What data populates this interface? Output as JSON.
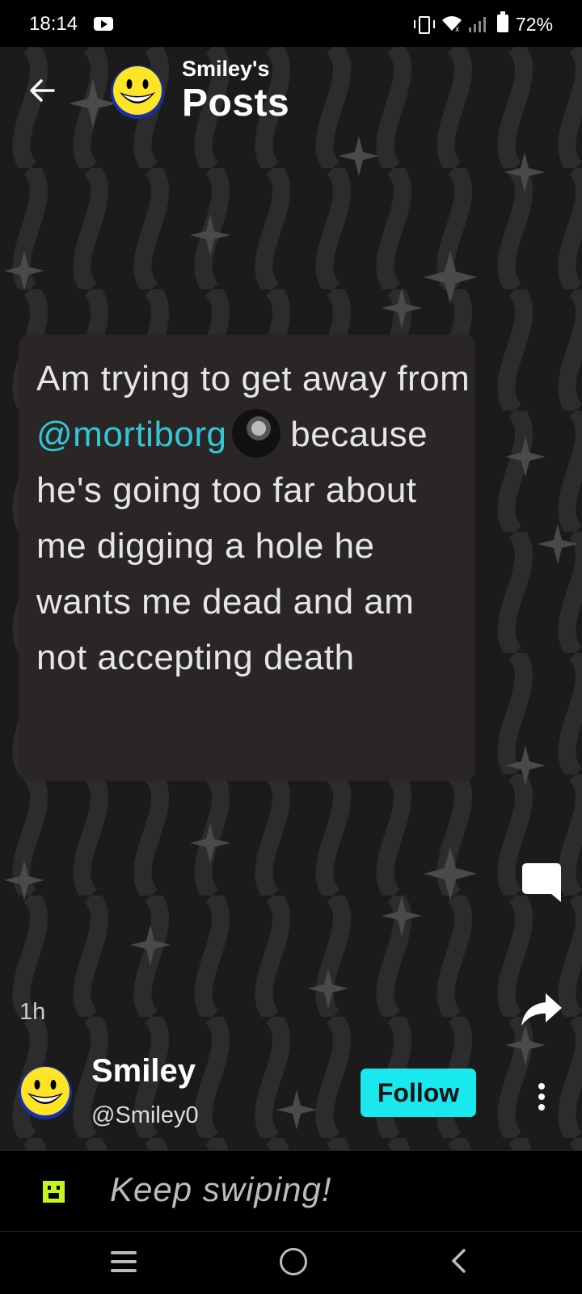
{
  "status_bar": {
    "time": "18:14",
    "battery": "72%"
  },
  "header": {
    "subtitle": "Smiley's",
    "title": "Posts"
  },
  "post": {
    "text_before": "Am trying to get away from ",
    "mention": "@mortiborg",
    "text_after": " because he's going too far about me digging a hole he wants me dead and am not accepting death",
    "time_ago": "1h"
  },
  "author": {
    "name": "Smiley",
    "handle": "@Smiley0",
    "follow_label": "Follow"
  },
  "footer": {
    "swipe_text": "Keep swiping!"
  },
  "colors": {
    "accent": "#19e8ee",
    "mention": "#32c7d6",
    "background": "#1b1b1b",
    "card": "#292625"
  }
}
